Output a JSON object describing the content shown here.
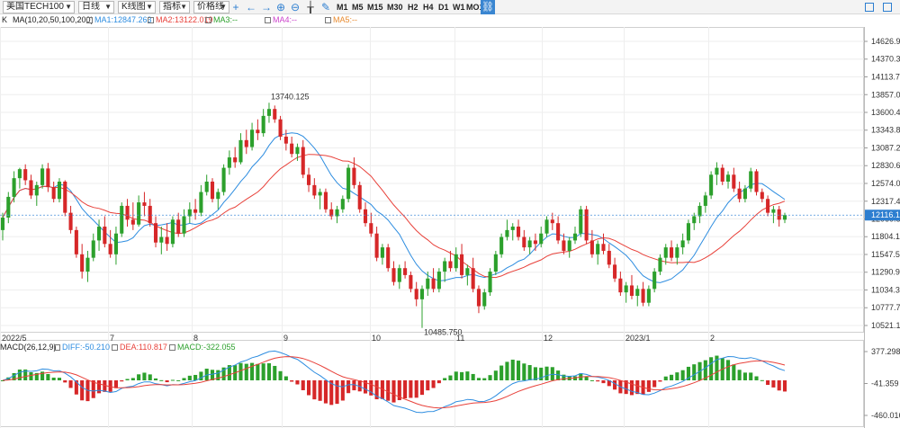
{
  "toolbar": {
    "symbol": "美国TECH100",
    "timeframe": "日线",
    "chart_style": "K线图",
    "indicator": "指标",
    "price_line": "价格线",
    "periods": [
      "M1",
      "M5",
      "M15",
      "M30",
      "H2",
      "H4",
      "D1",
      "W1",
      "MO1"
    ],
    "icons": [
      "crosshair-icon",
      "arrow-left-icon",
      "arrow-right-icon",
      "zoom-in-icon",
      "zoom-out-icon",
      "bar-style-icon",
      "pen-icon"
    ]
  },
  "ma_legend": {
    "collapse": "K",
    "params": "MA(10,20,50,100,200)",
    "ma1": "MA1:12847.263",
    "ma2": "MA2:13122.019",
    "ma3": "MA3:--",
    "ma4": "MA4:--",
    "ma5": "MA5:--"
  },
  "macd_legend": {
    "params": "MACD(26,12,9)",
    "diff": "DIFF:-50.210",
    "dea": "DEA:110.817",
    "macd": "MACD:-322.055"
  },
  "price_axis": [
    "14626.93",
    "14370.32",
    "14113.70",
    "13857.09",
    "13600.48",
    "13343.87",
    "13087.25",
    "12830.64",
    "12574.03",
    "12317.41",
    "12060.80",
    "11804.19",
    "11547.57",
    "11290.96",
    "11034.35",
    "10777.74",
    "10521.12"
  ],
  "current_price": "12116.11",
  "macd_axis": [
    "377.298",
    "-41.359",
    "-460.016"
  ],
  "annotations": {
    "high": "13740.125",
    "low": "10485.750"
  },
  "colors": {
    "up": "#2ca02c",
    "down": "#d62728",
    "ma1": "#2e8de0",
    "ma2": "#e8413a",
    "accent": "#2d7ed0"
  },
  "chart_data": {
    "type": "candlestick",
    "x_labels": [
      "2022/5",
      "7",
      "8",
      "9",
      "10",
      "11",
      "12",
      "2023/1",
      "2"
    ],
    "ohlc": [
      [
        11900,
        12150,
        11750,
        12080
      ],
      [
        12080,
        12450,
        12000,
        12380
      ],
      [
        12380,
        12750,
        12300,
        12650
      ],
      [
        12650,
        12800,
        12500,
        12780
      ],
      [
        12780,
        12850,
        12550,
        12620
      ],
      [
        12620,
        12700,
        12350,
        12400
      ],
      [
        12400,
        12600,
        12250,
        12550
      ],
      [
        12550,
        12850,
        12500,
        12790
      ],
      [
        12790,
        12870,
        12450,
        12520
      ],
      [
        12520,
        12600,
        12300,
        12350
      ],
      [
        12350,
        12650,
        12300,
        12600
      ],
      [
        12600,
        12620,
        12100,
        12150
      ],
      [
        12150,
        12250,
        11850,
        11900
      ],
      [
        11900,
        11950,
        11500,
        11550
      ],
      [
        11550,
        11700,
        11200,
        11300
      ],
      [
        11300,
        11600,
        11150,
        11500
      ],
      [
        11500,
        11850,
        11450,
        11750
      ],
      [
        11750,
        12050,
        11600,
        11950
      ],
      [
        11950,
        12100,
        11650,
        11700
      ],
      [
        11700,
        11900,
        11500,
        11550
      ],
      [
        11550,
        11950,
        11400,
        11850
      ],
      [
        11850,
        12300,
        11800,
        12250
      ],
      [
        12250,
        12350,
        11950,
        12050
      ],
      [
        12050,
        12300,
        11900,
        11980
      ],
      [
        11980,
        12400,
        11950,
        12300
      ],
      [
        12300,
        12450,
        12100,
        12250
      ],
      [
        12250,
        12350,
        11950,
        12000
      ],
      [
        12000,
        12100,
        11650,
        11720
      ],
      [
        11720,
        11950,
        11550,
        11800
      ],
      [
        11800,
        12000,
        11600,
        11700
      ],
      [
        11700,
        12100,
        11650,
        12050
      ],
      [
        12050,
        12150,
        11800,
        11850
      ],
      [
        11850,
        12200,
        11800,
        12100
      ],
      [
        12100,
        12300,
        12000,
        12200
      ],
      [
        12200,
        12350,
        12050,
        12150
      ],
      [
        12150,
        12550,
        12100,
        12450
      ],
      [
        12450,
        12700,
        12400,
        12600
      ],
      [
        12600,
        12650,
        12300,
        12350
      ],
      [
        12350,
        12500,
        12200,
        12450
      ],
      [
        12450,
        12850,
        12400,
        12800
      ],
      [
        12800,
        13050,
        12700,
        12950
      ],
      [
        12950,
        13100,
        12800,
        12880
      ],
      [
        12880,
        13300,
        12850,
        13200
      ],
      [
        13200,
        13350,
        13000,
        13100
      ],
      [
        13100,
        13450,
        13050,
        13350
      ],
      [
        13350,
        13500,
        13200,
        13300
      ],
      [
        13300,
        13650,
        13250,
        13550
      ],
      [
        13550,
        13740,
        13450,
        13650
      ],
      [
        13650,
        13700,
        13450,
        13500
      ],
      [
        13500,
        13550,
        13200,
        13250
      ],
      [
        13250,
        13350,
        13050,
        13150
      ],
      [
        13150,
        13250,
        12950,
        13000
      ],
      [
        13000,
        13150,
        12900,
        13100
      ],
      [
        13100,
        13200,
        12650,
        12700
      ],
      [
        12700,
        12800,
        12450,
        12550
      ],
      [
        12550,
        12650,
        12350,
        12400
      ],
      [
        12400,
        12500,
        12200,
        12450
      ],
      [
        12450,
        12500,
        12150,
        12200
      ],
      [
        12200,
        12300,
        12050,
        12100
      ],
      [
        12100,
        12250,
        12000,
        12200
      ],
      [
        12200,
        12400,
        12150,
        12350
      ],
      [
        12350,
        12850,
        12300,
        12800
      ],
      [
        12800,
        12950,
        12500,
        12550
      ],
      [
        12550,
        12600,
        12150,
        12200
      ],
      [
        12200,
        12300,
        11950,
        12000
      ],
      [
        12000,
        12150,
        11800,
        11850
      ],
      [
        11850,
        11950,
        11450,
        11500
      ],
      [
        11500,
        11700,
        11400,
        11650
      ],
      [
        11650,
        11700,
        11300,
        11350
      ],
      [
        11350,
        11450,
        11100,
        11150
      ],
      [
        11150,
        11400,
        11050,
        11350
      ],
      [
        11350,
        11450,
        11200,
        11250
      ],
      [
        11250,
        11300,
        11000,
        11050
      ],
      [
        11050,
        11150,
        10800,
        10900
      ],
      [
        10900,
        11100,
        10486,
        11050
      ],
      [
        11050,
        11300,
        10950,
        11200
      ],
      [
        11200,
        11350,
        11000,
        11050
      ],
      [
        11050,
        11350,
        11000,
        11300
      ],
      [
        11300,
        11500,
        11150,
        11450
      ],
      [
        11450,
        11600,
        11300,
        11350
      ],
      [
        11350,
        11650,
        11300,
        11550
      ],
      [
        11550,
        11700,
        11200,
        11250
      ],
      [
        11250,
        11400,
        11100,
        11350
      ],
      [
        11350,
        11500,
        11000,
        11050
      ],
      [
        11050,
        11100,
        10700,
        10800
      ],
      [
        10800,
        11050,
        10750,
        11000
      ],
      [
        11000,
        11350,
        10950,
        11300
      ],
      [
        11300,
        11600,
        11250,
        11550
      ],
      [
        11550,
        11850,
        11500,
        11800
      ],
      [
        11800,
        12050,
        11750,
        11900
      ],
      [
        11900,
        12000,
        11750,
        11950
      ],
      [
        11950,
        12050,
        11750,
        11800
      ],
      [
        11800,
        11900,
        11600,
        11650
      ],
      [
        11650,
        11800,
        11550,
        11750
      ],
      [
        11750,
        11850,
        11600,
        11700
      ],
      [
        11700,
        11950,
        11650,
        11850
      ],
      [
        11850,
        12100,
        11800,
        12050
      ],
      [
        12050,
        12150,
        11900,
        12000
      ],
      [
        12000,
        12100,
        11700,
        11750
      ],
      [
        11750,
        11850,
        11550,
        11600
      ],
      [
        11600,
        11800,
        11500,
        11750
      ],
      [
        11750,
        11950,
        11700,
        11850
      ],
      [
        11850,
        12250,
        11800,
        12200
      ],
      [
        12200,
        12250,
        11700,
        11750
      ],
      [
        11750,
        11900,
        11500,
        11550
      ],
      [
        11550,
        11750,
        11400,
        11700
      ],
      [
        11700,
        11850,
        11550,
        11600
      ],
      [
        11600,
        11700,
        11350,
        11400
      ],
      [
        11400,
        11500,
        11150,
        11200
      ],
      [
        11200,
        11300,
        10950,
        11000
      ],
      [
        11000,
        11150,
        10850,
        11100
      ],
      [
        11100,
        11250,
        10900,
        10950
      ],
      [
        10950,
        11100,
        10800,
        11050
      ],
      [
        11050,
        11150,
        10800,
        10850
      ],
      [
        10850,
        11100,
        10800,
        11050
      ],
      [
        11050,
        11350,
        11000,
        11300
      ],
      [
        11300,
        11550,
        11250,
        11500
      ],
      [
        11500,
        11700,
        11400,
        11650
      ],
      [
        11650,
        11750,
        11450,
        11500
      ],
      [
        11500,
        11700,
        11400,
        11650
      ],
      [
        11650,
        11850,
        11550,
        11750
      ],
      [
        11750,
        12050,
        11700,
        12000
      ],
      [
        12000,
        12150,
        11900,
        12100
      ],
      [
        12100,
        12300,
        12000,
        12250
      ],
      [
        12250,
        12450,
        12150,
        12400
      ],
      [
        12400,
        12750,
        12350,
        12700
      ],
      [
        12700,
        12880,
        12550,
        12800
      ],
      [
        12800,
        12850,
        12550,
        12600
      ],
      [
        12600,
        12750,
        12500,
        12700
      ],
      [
        12700,
        12800,
        12450,
        12500
      ],
      [
        12500,
        12600,
        12300,
        12350
      ],
      [
        12350,
        12550,
        12300,
        12500
      ],
      [
        12500,
        12800,
        12450,
        12750
      ],
      [
        12750,
        12780,
        12400,
        12450
      ],
      [
        12450,
        12500,
        12300,
        12350
      ],
      [
        12350,
        12400,
        12100,
        12150
      ],
      [
        12150,
        12250,
        12000,
        12200
      ],
      [
        12200,
        12250,
        11950,
        12050
      ],
      [
        12050,
        12150,
        12000,
        12116
      ]
    ],
    "ma_periods": [
      10,
      20
    ],
    "macd_params": [
      26,
      12,
      9
    ]
  }
}
